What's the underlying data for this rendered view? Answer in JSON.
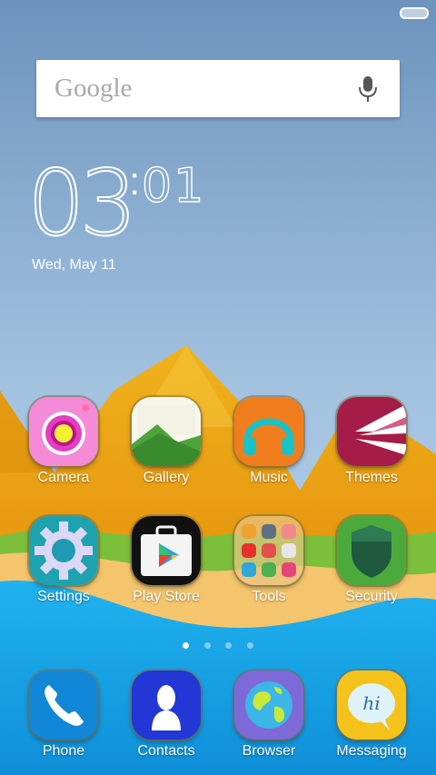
{
  "status_bar": {
    "battery_icon": "battery-icon"
  },
  "search": {
    "brand": "Google",
    "icon": "mic-icon"
  },
  "clock": {
    "hours": "03",
    "separator": ":",
    "minutes": "01",
    "date": "Wed, May 11"
  },
  "rows": [
    {
      "apps": [
        {
          "label": "Camera",
          "icon": "camera-icon"
        },
        {
          "label": "Gallery",
          "icon": "gallery-icon"
        },
        {
          "label": "Music",
          "icon": "headphones-icon"
        },
        {
          "label": "Themes",
          "icon": "themes-icon"
        }
      ]
    },
    {
      "apps": [
        {
          "label": "Settings",
          "icon": "gear-icon"
        },
        {
          "label": "Play Store",
          "icon": "play-store-icon"
        },
        {
          "label": "Tools",
          "icon": "folder-icon"
        },
        {
          "label": "Security",
          "icon": "shield-icon"
        }
      ]
    }
  ],
  "page_indicator": {
    "count": 4,
    "active": 1
  },
  "dock": [
    {
      "label": "Phone",
      "icon": "phone-icon"
    },
    {
      "label": "Contacts",
      "icon": "contacts-icon"
    },
    {
      "label": "Browser",
      "icon": "globe-icon"
    },
    {
      "label": "Messaging",
      "icon": "message-icon"
    }
  ],
  "colors": {
    "sky_top": "#6f96bf",
    "sky_bottom": "#a9c9e6",
    "mountain": "#e8a21a",
    "grass": "#7cbf3a",
    "sand": "#f4c56c",
    "water": "#1ba7ea"
  }
}
